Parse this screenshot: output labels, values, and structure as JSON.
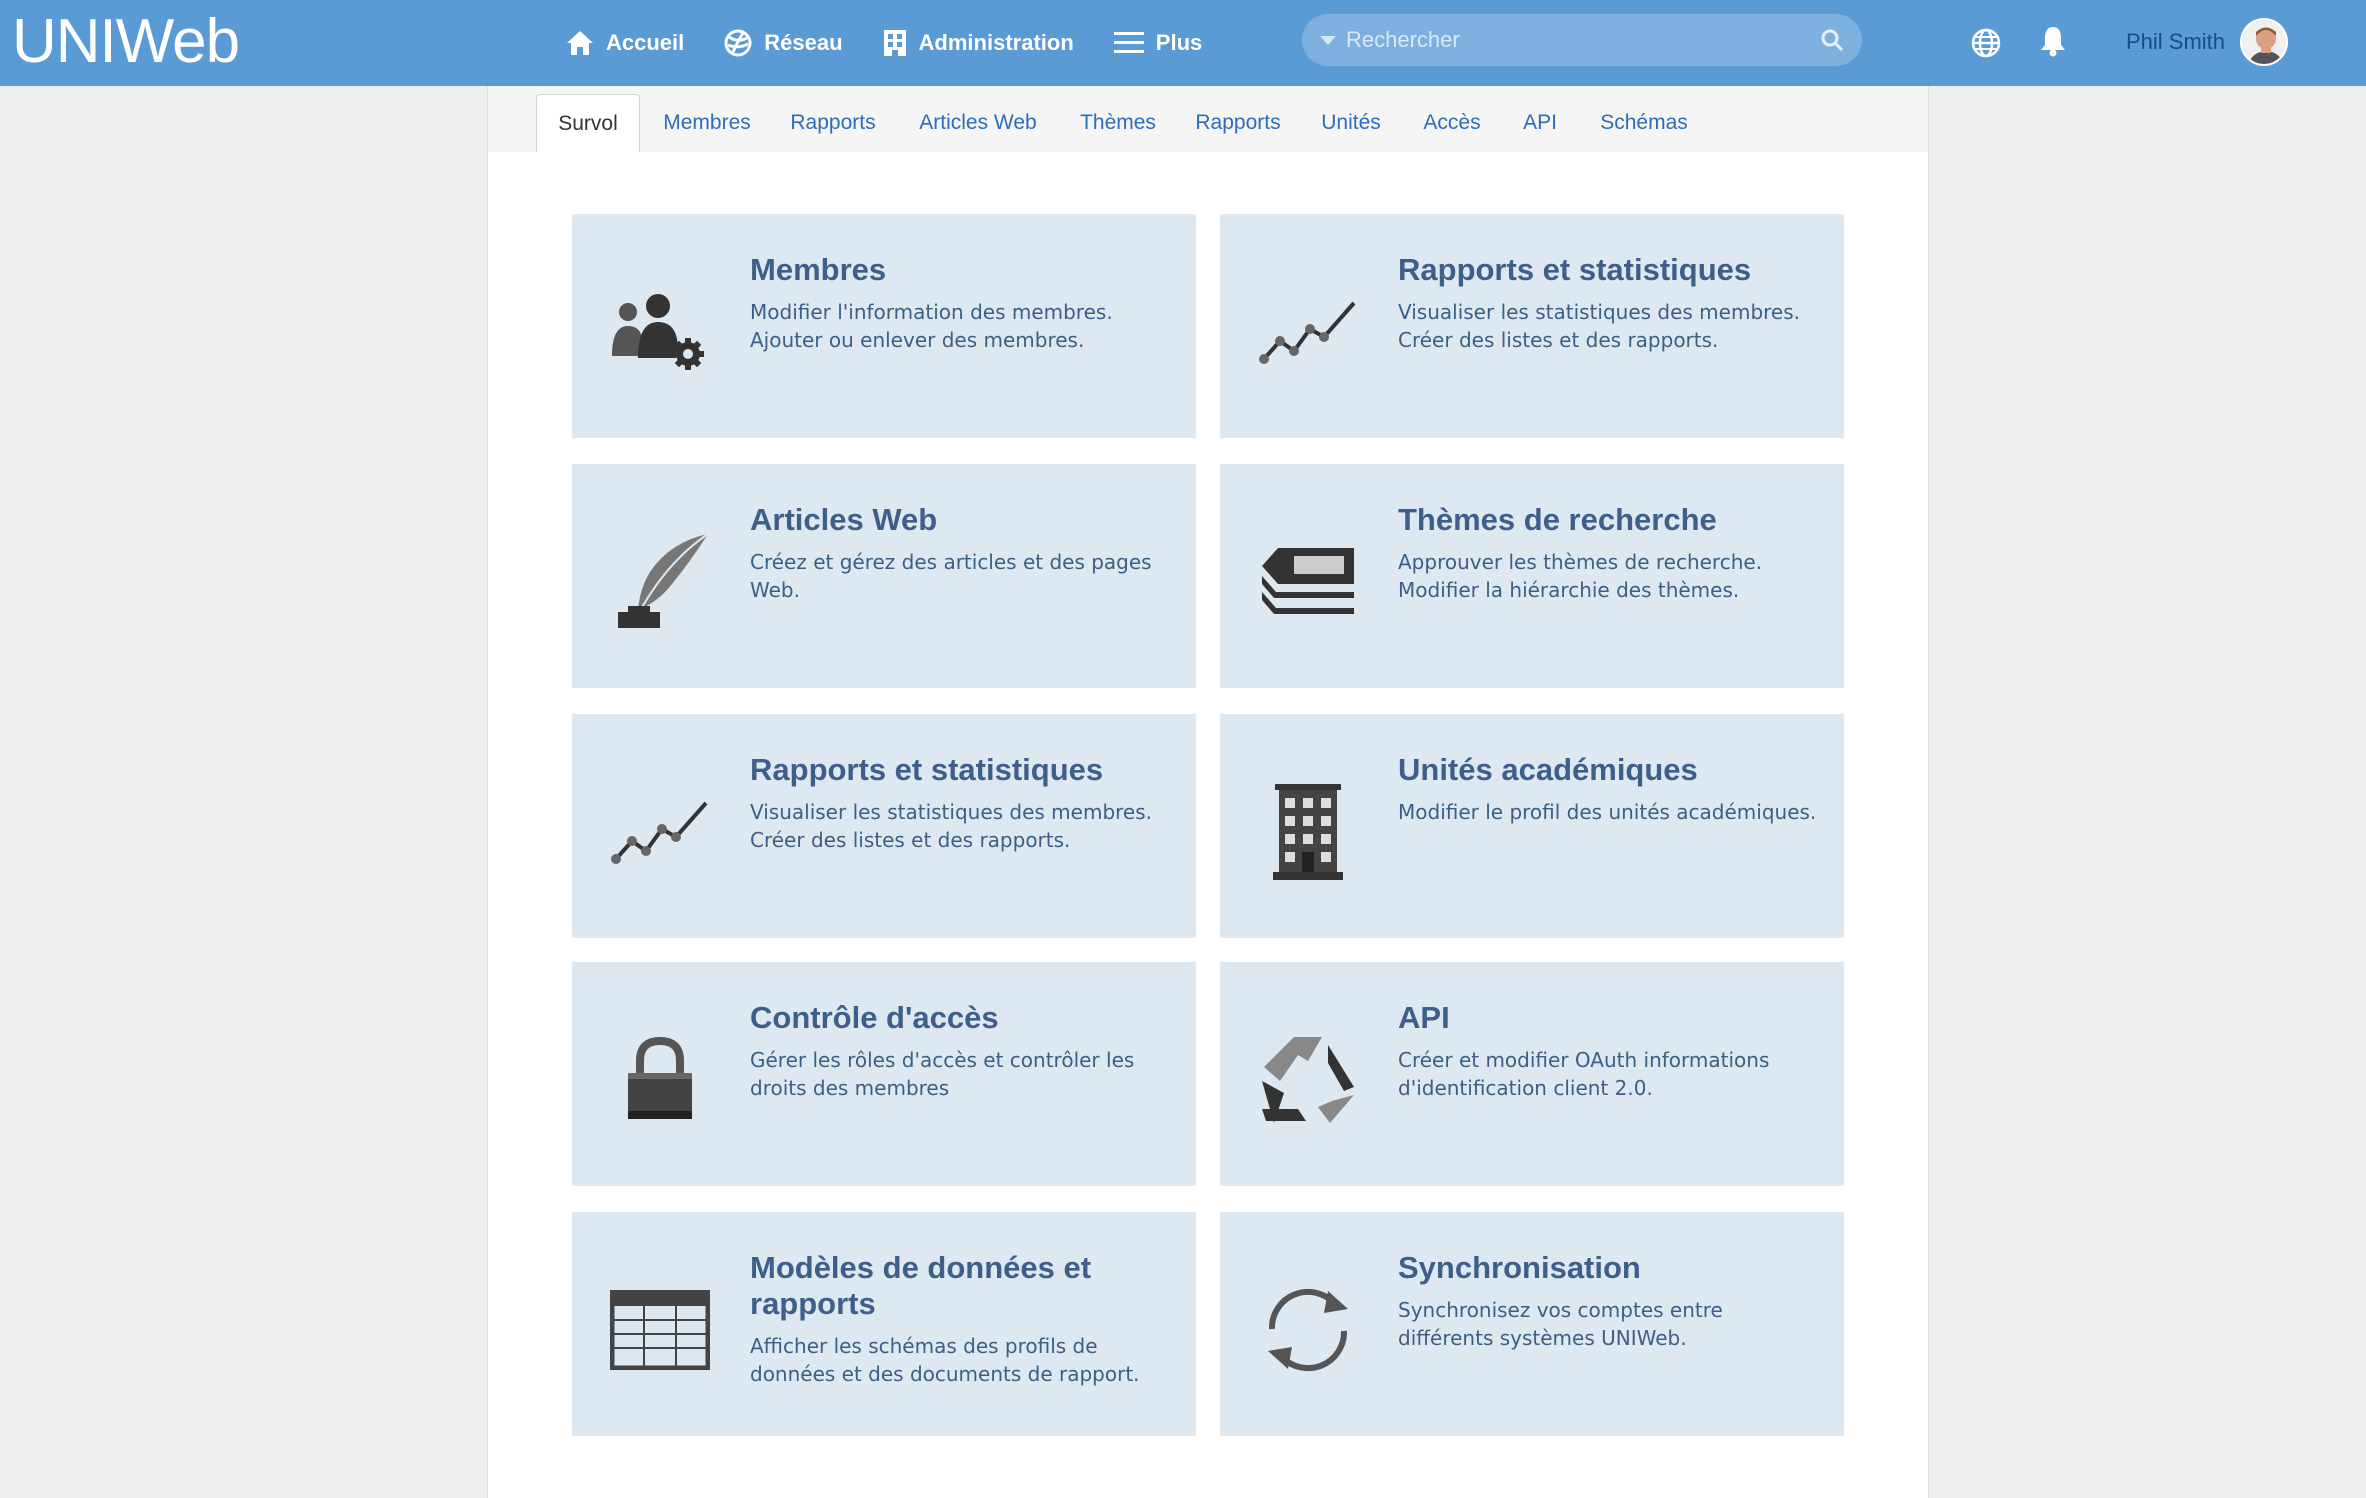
{
  "app": {
    "logo": "UNIWeb"
  },
  "nav": {
    "items": [
      {
        "label": "Accueil",
        "icon": "home-icon"
      },
      {
        "label": "Réseau",
        "icon": "network-icon"
      },
      {
        "label": "Administration",
        "icon": "building-icon"
      },
      {
        "label": "Plus",
        "icon": "menu-icon"
      }
    ]
  },
  "search": {
    "placeholder": "Rechercher"
  },
  "user": {
    "name": "Phil Smith"
  },
  "tabs": [
    {
      "label": "Survol",
      "active": true
    },
    {
      "label": "Membres"
    },
    {
      "label": "Rapports"
    },
    {
      "label": "Articles Web"
    },
    {
      "label": "Thèmes"
    },
    {
      "label": "Rapports"
    },
    {
      "label": "Unités"
    },
    {
      "label": "Accès"
    },
    {
      "label": "API"
    },
    {
      "label": "Schémas"
    }
  ],
  "cards": [
    {
      "title": "Membres",
      "desc": "Modifier l'information des membres. Ajouter ou enlever des membres.",
      "icon": "members-gear-icon"
    },
    {
      "title": "Rapports et statistiques",
      "desc": "Visualiser les statistiques des membres. Créer des listes et des rapports.",
      "icon": "line-chart-icon"
    },
    {
      "title": "Articles Web",
      "desc": "Créez et gérez des articles et des pages Web.",
      "icon": "quill-ink-icon"
    },
    {
      "title": "Thèmes de recherche",
      "desc": "Approuver les thèmes de recherche. Modifier la hiérarchie des thèmes.",
      "icon": "tags-icon"
    },
    {
      "title": "Rapports et statistiques",
      "desc": "Visualiser les statistiques des membres. Créer des listes et des rapports.",
      "icon": "line-chart-icon"
    },
    {
      "title": "Unités académiques",
      "desc": "Modifier le profil des unités académiques.",
      "icon": "building-icon"
    },
    {
      "title": "Contrôle d'accès",
      "desc": "Gérer les rôles d'accès et contrôler les droits des membres",
      "icon": "padlock-icon"
    },
    {
      "title": "API",
      "desc": "Créer et modifier OAuth informations d'identification client 2.0.",
      "icon": "recycle-arrows-icon"
    },
    {
      "title": "Modèles de données et rapports",
      "desc": "Afficher les schémas des profils de données et des documents de rapport.",
      "icon": "table-grid-icon"
    },
    {
      "title": "Synchronisation",
      "desc": "Synchronisez vos comptes entre différents systèmes UNIWeb.",
      "icon": "sync-icon"
    }
  ]
}
